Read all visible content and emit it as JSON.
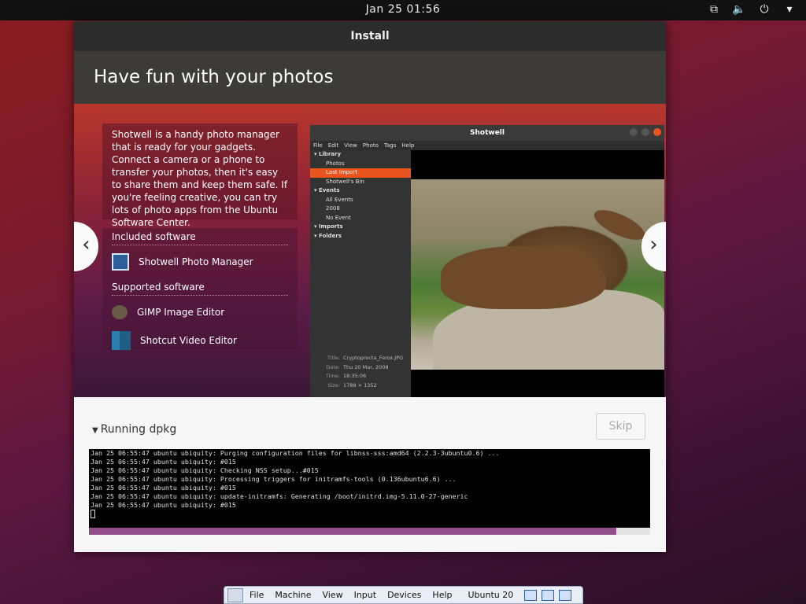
{
  "topbar": {
    "clock": "Jan 25  01:56",
    "icons": [
      "network-icon",
      "volume-icon",
      "power-icon",
      "dropdown-arrow-icon"
    ]
  },
  "window": {
    "title": "Install",
    "header": "Have fun with your photos",
    "description": "Shotwell is a handy photo manager that is ready for your gadgets. Connect a camera or a phone to transfer your photos, then it's easy to share them and keep them safe. If you're feeling creative, you can try lots of photo apps from the Ubuntu Software Center.",
    "included_title": "Included software",
    "included": [
      "Shotwell Photo Manager"
    ],
    "supported_title": "Supported software",
    "supported": [
      "GIMP Image Editor",
      "Shotcut Video Editor"
    ],
    "nav_prev": "‹",
    "nav_next": "›"
  },
  "screenshot": {
    "title": "Shotwell",
    "menu": [
      "File",
      "Edit",
      "View",
      "Photo",
      "Tags",
      "Help"
    ],
    "tree": [
      {
        "label": "Library",
        "bold": true,
        "level": 0
      },
      {
        "label": "Photos",
        "level": 1
      },
      {
        "label": "Last Import",
        "level": 1,
        "selected": true
      },
      {
        "label": "Shotwell's Bin",
        "level": 1
      },
      {
        "label": "Events",
        "bold": true,
        "level": 0
      },
      {
        "label": "All Events",
        "level": 1
      },
      {
        "label": "2008",
        "level": 1
      },
      {
        "label": "No Event",
        "level": 1
      },
      {
        "label": "Imports",
        "bold": true,
        "level": 0
      },
      {
        "label": "Folders",
        "bold": true,
        "level": 0
      }
    ],
    "meta": [
      {
        "k": "Title:",
        "v": "Cryptoprocta_Ferox.JPG"
      },
      {
        "k": "Date:",
        "v": "Thu 20 Mar, 2008"
      },
      {
        "k": "Time:",
        "v": "18:35:06"
      },
      {
        "k": "Size:",
        "v": "1788 × 1352"
      }
    ]
  },
  "progress": {
    "label": "Running dpkg",
    "skip": "Skip",
    "percent": 0.94,
    "log": [
      "Jan 25 06:55:47 ubuntu ubiquity: Purging configuration files for libnss-sss:amd64 (2.2.3-3ubuntu0.6) ...",
      "Jan 25 06:55:47 ubuntu ubiquity: #015",
      "Jan 25 06:55:47 ubuntu ubiquity: Checking NSS setup...#015",
      "Jan 25 06:55:47 ubuntu ubiquity: Processing triggers for initramfs-tools (0.136ubuntu6.6) ...",
      "Jan 25 06:55:47 ubuntu ubiquity: #015",
      "Jan 25 06:55:47 ubuntu ubiquity: update-initramfs: Generating /boot/initrd.img-5.11.0-27-generic",
      "Jan 25 06:55:47 ubuntu ubiquity: #015"
    ]
  },
  "vbox": {
    "menus": [
      "File",
      "Machine",
      "View",
      "Input",
      "Devices",
      "Help"
    ],
    "vm_name": "Ubuntu 20"
  },
  "colors": {
    "accent": "#e95420",
    "progress_fill": "#924d8b",
    "titlebar": "#2c2c2c",
    "header": "#3c3b37"
  }
}
